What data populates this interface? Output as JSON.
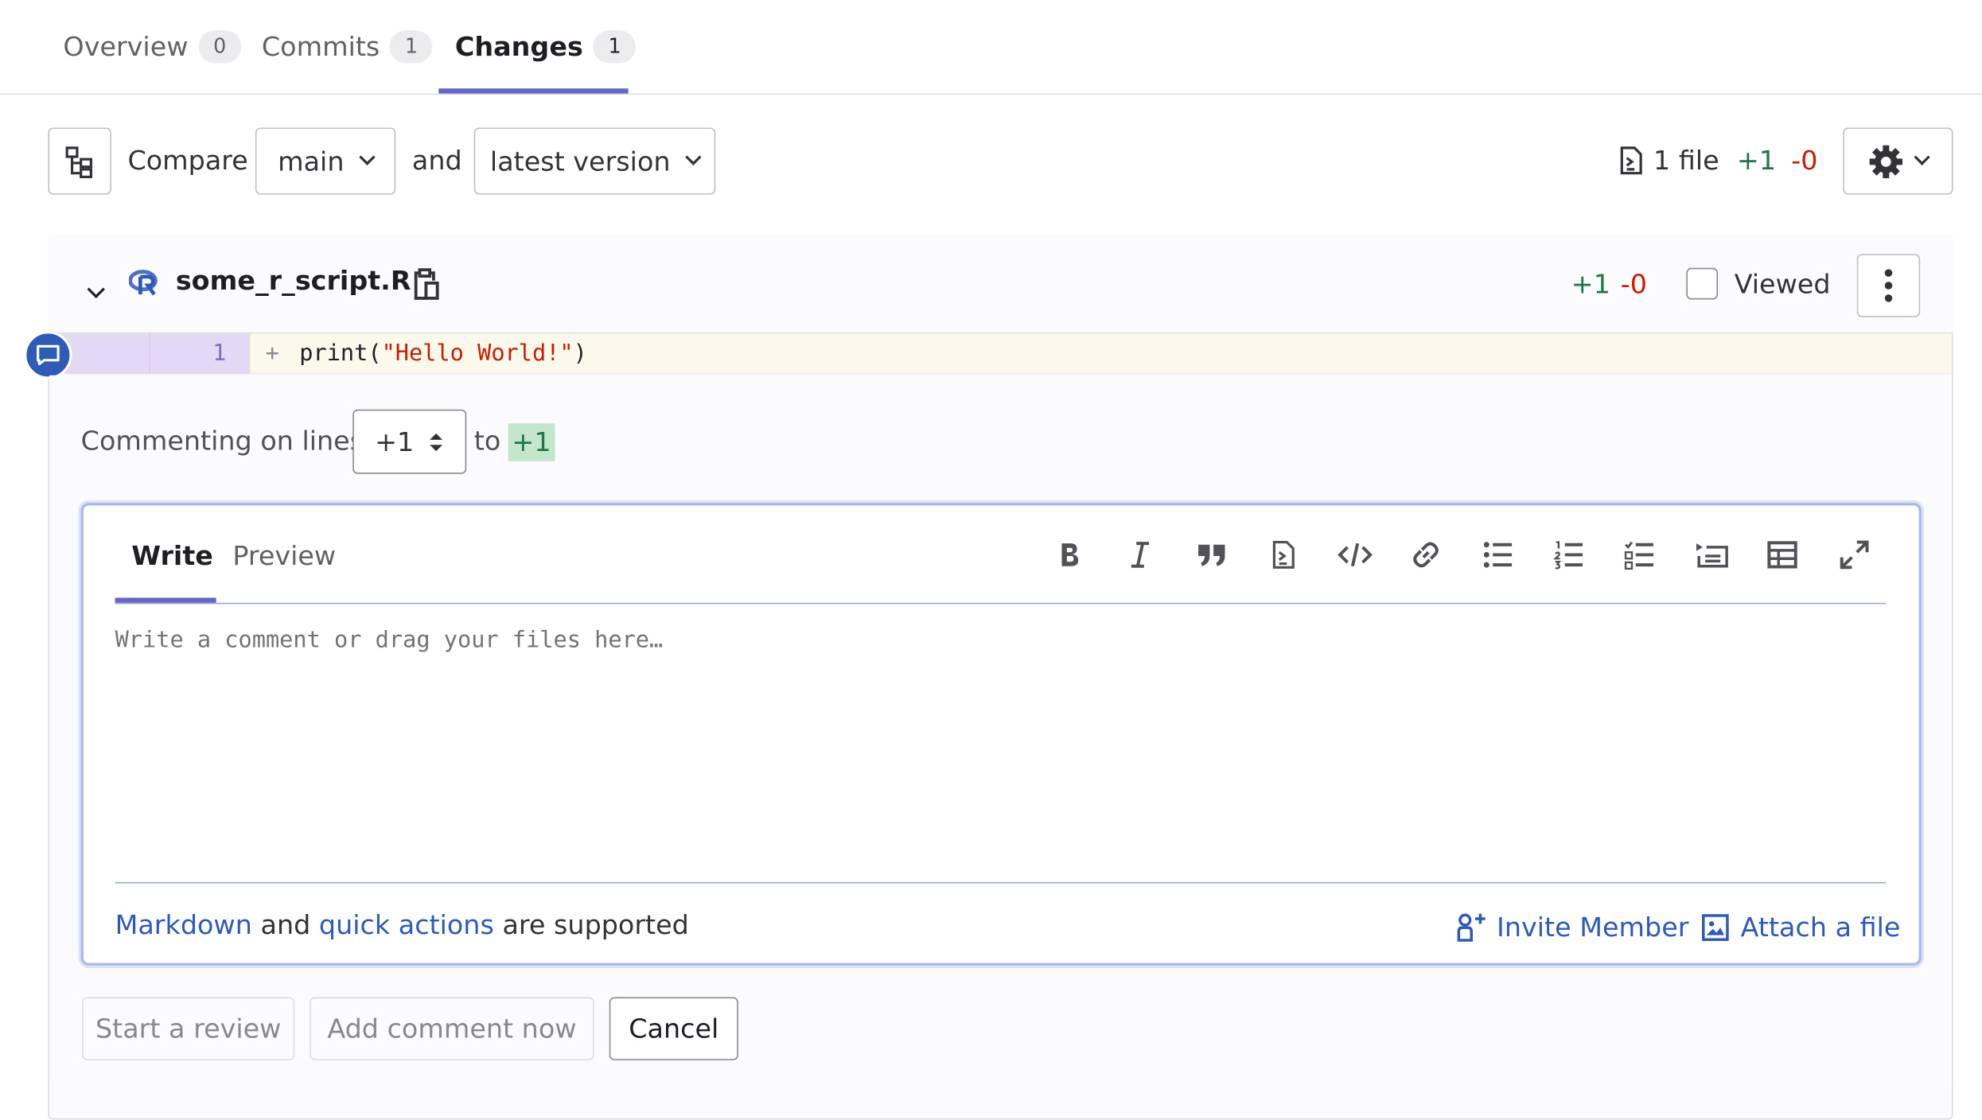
{
  "tabs": [
    {
      "label": "Overview",
      "count": "0"
    },
    {
      "label": "Commits",
      "count": "1"
    },
    {
      "label": "Changes",
      "count": "1"
    }
  ],
  "compare": {
    "label": "Compare",
    "source": "main",
    "and": "and",
    "target": "latest version"
  },
  "stats": {
    "files": "1 file",
    "added": "+1",
    "removed": "-0"
  },
  "file": {
    "name": "some_r_script.R",
    "added": "+1",
    "removed": "-0",
    "viewed_label": "Viewed"
  },
  "diff": {
    "new_line": "1",
    "marker": "+",
    "code_prefix": "print(",
    "code_string": "\"Hello World!\"",
    "code_suffix": ")"
  },
  "comment": {
    "lines_label": "Commenting on lines",
    "from": "+1",
    "to_label": "to",
    "to": "+1",
    "tab_write": "Write",
    "tab_preview": "Preview",
    "placeholder": "Write a comment or drag your files here…",
    "markdown_link": "Markdown",
    "and_text": "and",
    "quick_actions_link": "quick actions",
    "supported_text": "are supported",
    "invite_member": "Invite Member",
    "attach_file": "Attach a file"
  },
  "actions": {
    "start_review": "Start a review",
    "add_comment": "Add comment now",
    "cancel": "Cancel"
  },
  "colors": {
    "accent": "#6666c4",
    "link": "#2f5bb7",
    "added": "#217645",
    "removed": "#c91c00"
  }
}
